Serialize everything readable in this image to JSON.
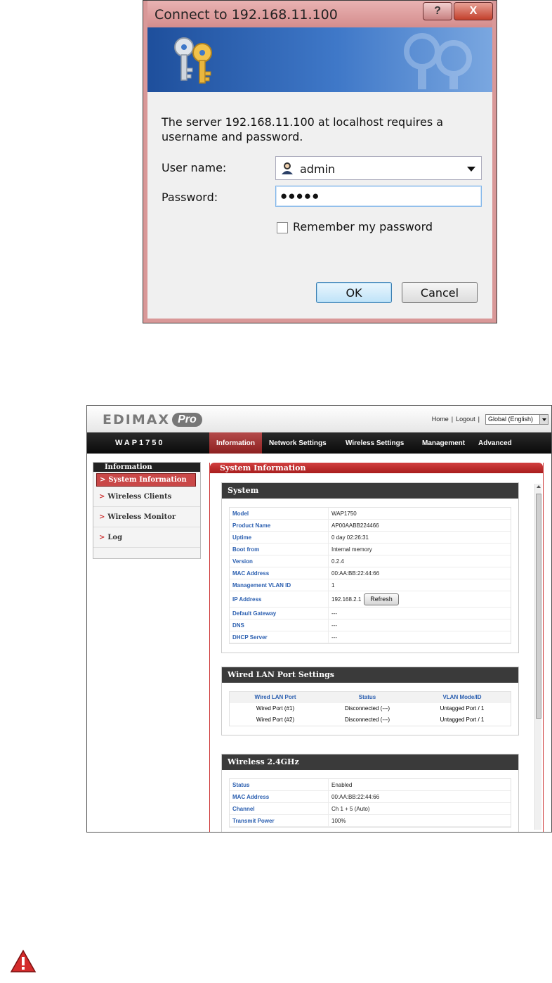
{
  "dialog": {
    "title": "Connect to 192.168.11.100",
    "help_label": "?",
    "close_label": "X",
    "message": "The server 192.168.11.100 at localhost requires a username and password.",
    "username_label": "User name:",
    "username_value": "admin",
    "password_label": "Password:",
    "password_value": "●●●●●",
    "remember_label": "Remember my password",
    "remember_checked": false,
    "ok_label": "OK",
    "cancel_label": "Cancel"
  },
  "router": {
    "logo_text": "EDIMAX",
    "logo_pro": "Pro",
    "top_links": [
      "Home",
      "|",
      "Logout",
      "|"
    ],
    "language": "Global (English)",
    "model": "WAP1750",
    "nav": [
      {
        "label": "Information",
        "active": true
      },
      {
        "label": "Network Settings",
        "active": false
      },
      {
        "label": "Wireless Settings",
        "active": false
      },
      {
        "label": "Management",
        "active": false
      },
      {
        "label": "Advanced",
        "active": false
      }
    ],
    "sidebar": {
      "heading": "Information",
      "items": [
        {
          "label": "System Information",
          "active": true
        },
        {
          "label": "Wireless Clients",
          "active": false
        },
        {
          "label": "Wireless Monitor",
          "active": false
        },
        {
          "label": "Log",
          "active": false
        }
      ]
    },
    "main_title": "System Information",
    "system": {
      "title": "System",
      "rows": [
        {
          "k": "Model",
          "v": "WAP1750"
        },
        {
          "k": "Product Name",
          "v": "AP00AABB224466"
        },
        {
          "k": "Uptime",
          "v": "0 day 02:26:31"
        },
        {
          "k": "Boot from",
          "v": "Internal memory"
        },
        {
          "k": "Version",
          "v": "0.2.4"
        },
        {
          "k": "MAC Address",
          "v": "00:AA:BB:22:44:66"
        },
        {
          "k": "Management VLAN ID",
          "v": "1"
        },
        {
          "k": "IP Address",
          "v": "192.168.2.1"
        },
        {
          "k": "Default Gateway",
          "v": "---"
        },
        {
          "k": "DNS",
          "v": "---"
        },
        {
          "k": "DHCP Server",
          "v": "---"
        }
      ],
      "refresh_label": "Refresh"
    },
    "wired": {
      "title": "Wired LAN Port Settings",
      "headers": [
        "Wired LAN Port",
        "Status",
        "VLAN Mode/ID"
      ],
      "rows": [
        [
          "Wired Port (#1)",
          "Disconnected (---)",
          "Untagged Port  /  1"
        ],
        [
          "Wired Port (#2)",
          "Disconnected (---)",
          "Untagged Port  /  1"
        ]
      ]
    },
    "wireless24": {
      "title": "Wireless 2.4GHz",
      "rows": [
        {
          "k": "Status",
          "v": "Enabled"
        },
        {
          "k": "MAC Address",
          "v": "00:AA:BB:22:44:66"
        },
        {
          "k": "Channel",
          "v": "Ch 1 + 5 (Auto)"
        },
        {
          "k": "Transmit Power",
          "v": "100%"
        }
      ]
    }
  },
  "colors": {
    "dialog_frame": "#d99898",
    "banner_blue": "#2f63b5",
    "router_accent": "#c33333",
    "label_blue": "#2b5fb0"
  }
}
